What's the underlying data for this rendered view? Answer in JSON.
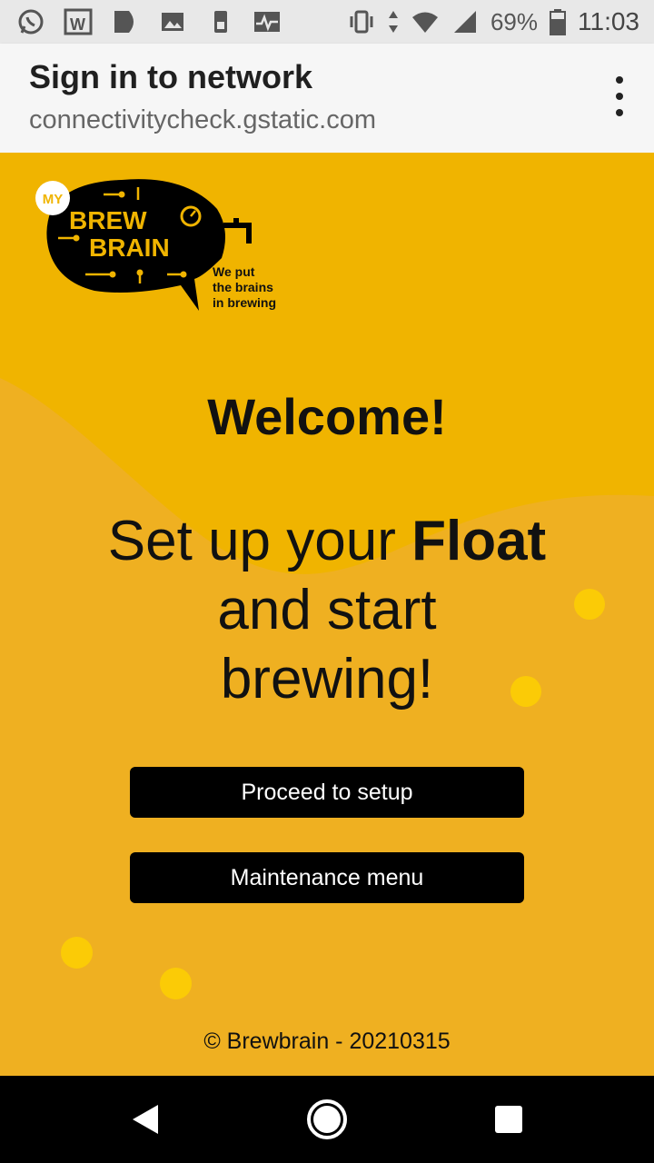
{
  "status_bar": {
    "left_icons": [
      "whatsapp-icon",
      "word-icon",
      "play-icon",
      "image-icon",
      "sim-card-icon",
      "activity-icon"
    ],
    "right_icons": [
      "vibrate-icon",
      "data-arrows-icon",
      "wifi-icon",
      "signal-icon",
      "battery-icon"
    ],
    "battery": "69%",
    "time": "11:03"
  },
  "header": {
    "title": "Sign in to network",
    "url": "connectivitycheck.gstatic.com",
    "menu_icon": "more-vert-icon"
  },
  "logo": {
    "badge": "MY",
    "line1": "BREW",
    "line2": "BRAIN",
    "tagline1": "We put",
    "tagline2": "the brains",
    "tagline3": "in brewing"
  },
  "main": {
    "welcome": "Welcome!",
    "headline_pre": "Set up your ",
    "headline_bold": "Float",
    "headline_line2": "and start",
    "headline_line3": "brewing!",
    "proceed_label": "Proceed to setup",
    "maintenance_label": "Maintenance menu",
    "footer": "© Brewbrain - 20210315"
  },
  "colors": {
    "background": "#efb021",
    "wave": "#f0b400",
    "dots": "#fbcb06",
    "button": "#000000"
  },
  "nav_bar": {
    "icons": [
      "back-icon",
      "home-icon",
      "recents-icon"
    ]
  }
}
